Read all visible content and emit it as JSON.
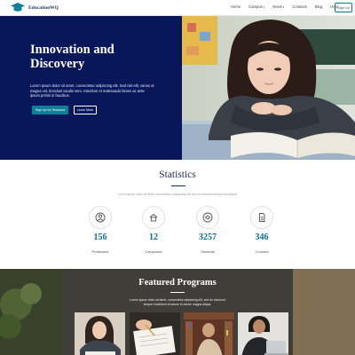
{
  "brand": {
    "name": "EducationWQ"
  },
  "nav": {
    "items": [
      {
        "label": "Home",
        "caret": ""
      },
      {
        "label": "Campus",
        "caret": "▾"
      },
      {
        "label": "News",
        "caret": "▾"
      },
      {
        "label": "Contacts",
        "caret": ""
      },
      {
        "label": "Blog",
        "caret": ""
      },
      {
        "label": "Help",
        "caret": ""
      }
    ],
    "signup": "Sign Up"
  },
  "hero": {
    "title_line1": "Innovation and",
    "title_line2": "Discovery",
    "text": "Lorem ipsum dolor sit amet, consectetur adipiscing elit. Sed nisl elit, varius ut magna vel, tincidunt iaculis sem. Interdum et malesuada fames ac ante ipsum primis in faucibus.",
    "primary_button": "Sign Up for Sessions",
    "secondary_button": "Learn More"
  },
  "statistics": {
    "title": "Statistics",
    "subtitle": "Lorem ipsum dolor sit amet, consectetur adipiscing elit, sed do eiusmod tempor incididunt",
    "items": [
      {
        "icon": "professor-icon",
        "value": "156",
        "label": "Professors"
      },
      {
        "icon": "campus-icon",
        "value": "12",
        "label": "Campuses"
      },
      {
        "icon": "students-icon",
        "value": "3257",
        "label": "Students"
      },
      {
        "icon": "courses-icon",
        "value": "346",
        "label": "Courses"
      }
    ]
  },
  "featured": {
    "title": "Featured Programs",
    "subtitle_line1": "Lorem ipsum dolor sit amet, consectetur adipiscing elit, sed do eiusmod",
    "subtitle_line2": "tempor incididunt ut labore et dolore magna aliqua."
  },
  "colors": {
    "hero_navy": "#07175a",
    "accent_teal": "#0f7f98",
    "stat_number": "#0e6f8f"
  }
}
